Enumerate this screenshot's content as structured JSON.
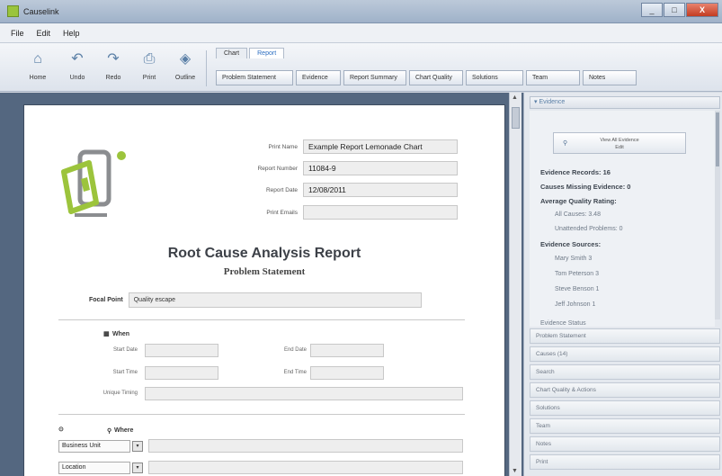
{
  "window": {
    "title": "Causelink",
    "buttons": [
      "_",
      "□",
      "X"
    ]
  },
  "menu": {
    "items": [
      "File",
      "Edit",
      "Help"
    ]
  },
  "toolbar": {
    "tools": [
      {
        "label": "Home",
        "icon": "home-icon"
      },
      {
        "label": "Undo",
        "icon": "undo-icon"
      },
      {
        "label": "Redo",
        "icon": "redo-icon"
      },
      {
        "label": "Print",
        "icon": "print-icon"
      },
      {
        "label": "Outline",
        "icon": "outline-icon"
      }
    ]
  },
  "ribbon": {
    "tabs": [
      "Chart",
      "Report"
    ],
    "active_tab": "Report",
    "buttons": [
      "Problem Statement",
      "Evidence",
      "Report Summary",
      "Chart Quality",
      "Solutions",
      "Team",
      "Notes"
    ]
  },
  "report": {
    "fields": [
      {
        "label": "Print Name",
        "value": "Example Report Lemonade Chart"
      },
      {
        "label": "Report Number",
        "value": "11084-9"
      },
      {
        "label": "Report Date",
        "value": "12/08/2011"
      },
      {
        "label": "Print Emails",
        "value": ""
      }
    ],
    "title": "Root Cause Analysis Report",
    "subtitle": "Problem Statement",
    "focal_label": "Focal Point",
    "focal_value": "Quality escape",
    "when": {
      "heading": "When",
      "start_date": "Start Date",
      "end_date": "End Date",
      "start_time": "Start Time",
      "end_time": "End Time",
      "unique_timing": "Unique Timing"
    },
    "where": {
      "heading": "Where",
      "business_unit": "Business Unit",
      "location": "Location"
    }
  },
  "panel": {
    "heading": "Evidence",
    "view_button_line1": "View All Evidence",
    "view_button_line2": "Edit",
    "evidence_records": "Evidence Records: 16",
    "causes_missing": "Causes Missing Evidence: 0",
    "avg_quality": "Average Quality Rating:",
    "all_causes": "All Causes: 3.48",
    "unattended": "Unattended Problems: 0",
    "sources_heading": "Evidence Sources:",
    "sources": [
      "Mary Smith 3",
      "Tom Peterson 3",
      "Steve Benson 1",
      "Jeff Johnson 1"
    ],
    "partial": "Evidence Status",
    "accordion": [
      "Problem Statement",
      "Causes (14)",
      "Search",
      "Chart Quality & Actions",
      "Solutions",
      "Team",
      "Notes",
      "Print"
    ]
  }
}
